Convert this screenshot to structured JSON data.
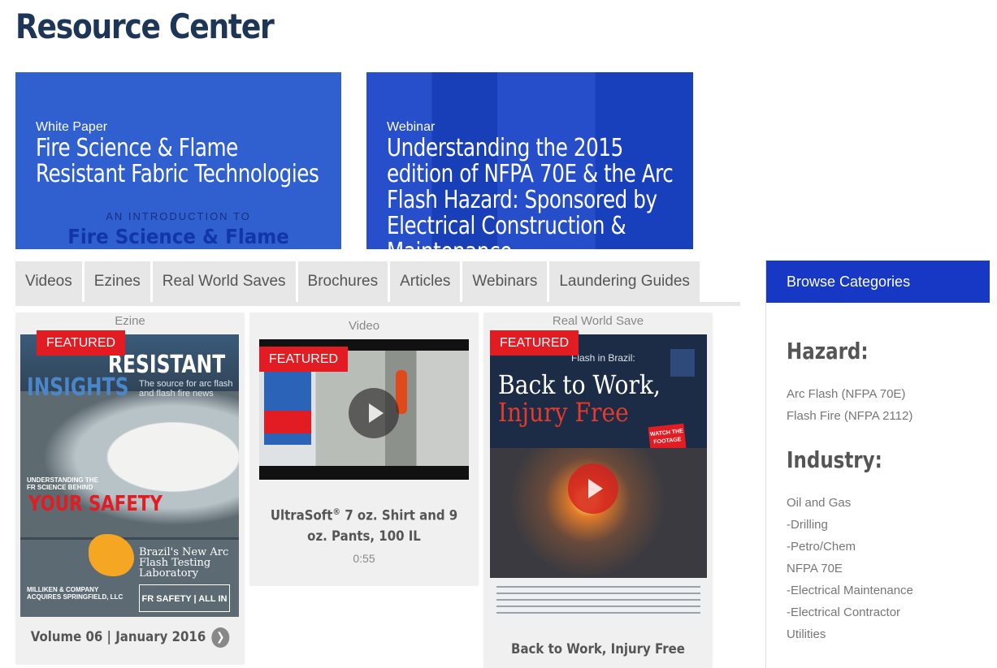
{
  "page": {
    "title": "Resource Center"
  },
  "heroes": [
    {
      "kind": "White Paper",
      "headline": "Fire Science & Flame Resistant Fabric Technologies",
      "intro": "AN INTRODUCTION TO",
      "intro_title": "Fire Science & Flame"
    },
    {
      "kind": "Webinar",
      "headline": "Understanding the 2015 edition of NFPA 70E & the Arc Flash Hazard: Sponsored by Electrical Construction & Maintenance"
    }
  ],
  "tabs": [
    "Videos",
    "Ezines",
    "Real World Saves",
    "Brochures",
    "Articles",
    "Webinars",
    "Laundering Guides"
  ],
  "cards": [
    {
      "type": "Ezine",
      "badge": "FEATURED",
      "title": "Volume 06 | January 2016",
      "cover": {
        "masthead_top": "RESISTANT",
        "masthead_left": "INSIGHTS",
        "tagline": "The source for arc flash and flash fire news",
        "understanding": "UNDERSTANDING THE FR SCIENCE BEHIND",
        "your_safety": "YOUR SAFETY",
        "brazil": "Brazil's New Arc Flash Testing Laboratory",
        "milliken": "MILLIKEN & COMPANY ACQUIRES SPRINGFIELD, LLC",
        "fr_box": "FR SAFETY | ALL IN"
      }
    },
    {
      "type": "Video",
      "badge": "FEATURED",
      "title_main": "UltraSoft",
      "title_sup": "®",
      "title_rest": " 7 oz. Shirt and 9 oz. Pants, 100 IL",
      "duration": "0:55"
    },
    {
      "type": "Real World Save",
      "badge": "FEATURED",
      "title": "Back to Work, Injury Free",
      "cover": {
        "header": "Flash in Brazil:",
        "line1": "Back to Work,",
        "line2": "Injury Free",
        "watch": "WATCH THE FOOTAGE"
      }
    }
  ],
  "sidebar": {
    "header": "Browse Categories",
    "hazard_heading": "Hazard:",
    "hazard_items": [
      "Arc Flash (NFPA 70E)",
      "Flash Fire (NFPA 2112)"
    ],
    "industry_heading": "Industry:",
    "industry_items": [
      "Oil and Gas",
      " -Drilling",
      " -Petro/Chem",
      "NFPA 70E",
      " -Electrical Maintenance",
      " -Electrical Contractor",
      "Utilities"
    ]
  },
  "colors": {
    "title": "#1d3557",
    "accent_blue": "#1638c4",
    "featured_red": "#e31b23",
    "tab_bg": "#e7e7e7"
  }
}
